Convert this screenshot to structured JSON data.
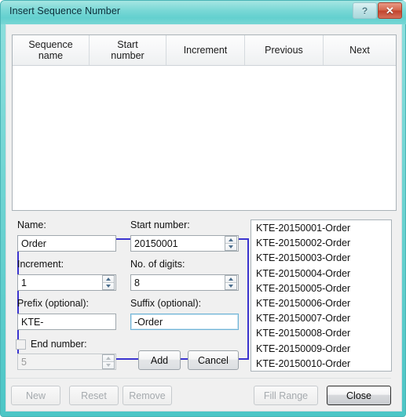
{
  "window": {
    "title": "Insert Sequence Number",
    "help_button": "?",
    "close_button": "✕",
    "frame_color": "#6fd4d2",
    "accent_panel_border": "#3b34cf"
  },
  "grid": {
    "columns": [
      {
        "label_line1": "Sequence",
        "label_line2": "name"
      },
      {
        "label_line1": "Start",
        "label_line2": "number"
      },
      {
        "label_line1": "Increment",
        "label_line2": ""
      },
      {
        "label_line1": "Previous",
        "label_line2": ""
      },
      {
        "label_line1": "Next",
        "label_line2": ""
      }
    ],
    "rows": []
  },
  "settings": {
    "name": {
      "label": "Name:",
      "value": "Order",
      "placeholder": ""
    },
    "start_number": {
      "label": "Start number:",
      "value": "20150001",
      "placeholder": ""
    },
    "increment": {
      "label": "Increment:",
      "value": "1",
      "placeholder": ""
    },
    "digits": {
      "label": "No. of digits:",
      "value": "8",
      "placeholder": ""
    },
    "prefix": {
      "label": "Prefix (optional):",
      "value": "KTE-",
      "placeholder": ""
    },
    "suffix": {
      "label": "Suffix (optional):",
      "value": "-Order",
      "placeholder": ""
    }
  },
  "end_number": {
    "label": "End number:",
    "checked": false,
    "value": "5",
    "enabled": false
  },
  "preview": {
    "items": [
      "KTE-20150001-Order",
      "KTE-20150002-Order",
      "KTE-20150003-Order",
      "KTE-20150004-Order",
      "KTE-20150005-Order",
      "KTE-20150006-Order",
      "KTE-20150007-Order",
      "KTE-20150008-Order",
      "KTE-20150009-Order",
      "KTE-20150010-Order"
    ]
  },
  "actions": {
    "add": "Add",
    "cancel": "Cancel",
    "new": "New",
    "reset": "Reset",
    "remove": "Remove",
    "fill_range": "Fill Range",
    "close": "Close"
  }
}
